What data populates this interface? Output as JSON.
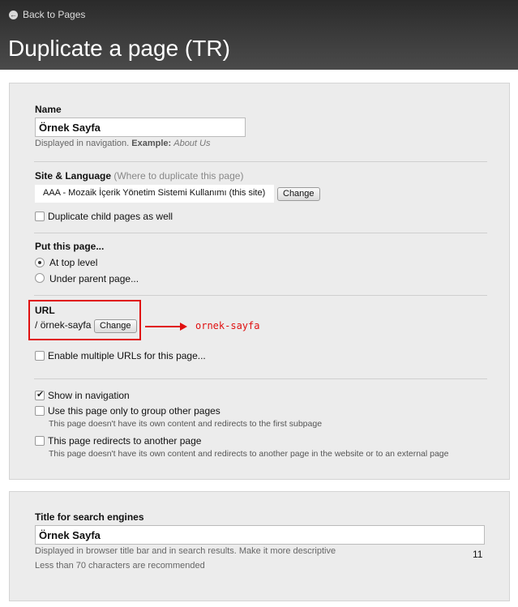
{
  "header": {
    "back_label": "Back to Pages",
    "title": "Duplicate a page (TR)"
  },
  "name": {
    "label": "Name",
    "value": "Örnek Sayfa",
    "help_text": "Displayed in navigation.",
    "example_label": "Example:",
    "example_value": "About Us"
  },
  "site_language": {
    "label": "Site & Language",
    "note": "(Where to duplicate this page)",
    "selected": "AAA - Mozaik İçerik Yönetim Sistemi Kullanımı (this site)",
    "change_label": "Change",
    "duplicate_children_label": "Duplicate child pages as well",
    "duplicate_children_checked": false
  },
  "placement": {
    "label": "Put this page...",
    "options": [
      {
        "label": "At top level",
        "checked": true
      },
      {
        "label": "Under parent page...",
        "checked": false
      }
    ]
  },
  "url": {
    "label": "URL",
    "prefix": "/",
    "value": "örnek-sayfa",
    "change_label": "Change",
    "annotation": "ornek-sayfa",
    "multiple_urls_label": "Enable multiple URLs for this page...",
    "multiple_urls_checked": false
  },
  "navigation": {
    "show_in_nav_label": "Show in navigation",
    "show_in_nav_checked": true,
    "group_only_label": "Use this page only to group other pages",
    "group_only_checked": false,
    "group_only_help": "This page doesn't have its own content and redirects to the first subpage",
    "redirect_label": "This page redirects to another page",
    "redirect_checked": false,
    "redirect_help": "This page doesn't have its own content and redirects to another page in the website or to an external page"
  },
  "seo": {
    "label": "Title for search engines",
    "value": "Örnek Sayfa",
    "help_text": "Displayed in browser title bar and in search results. Make it more descriptive",
    "char_count": "11",
    "recommendation": "Less than 70 characters are recommended"
  },
  "colors": {
    "annotation_red": "#e01010",
    "header_bg": "#3b3b3b",
    "panel_bg": "#ececec"
  }
}
